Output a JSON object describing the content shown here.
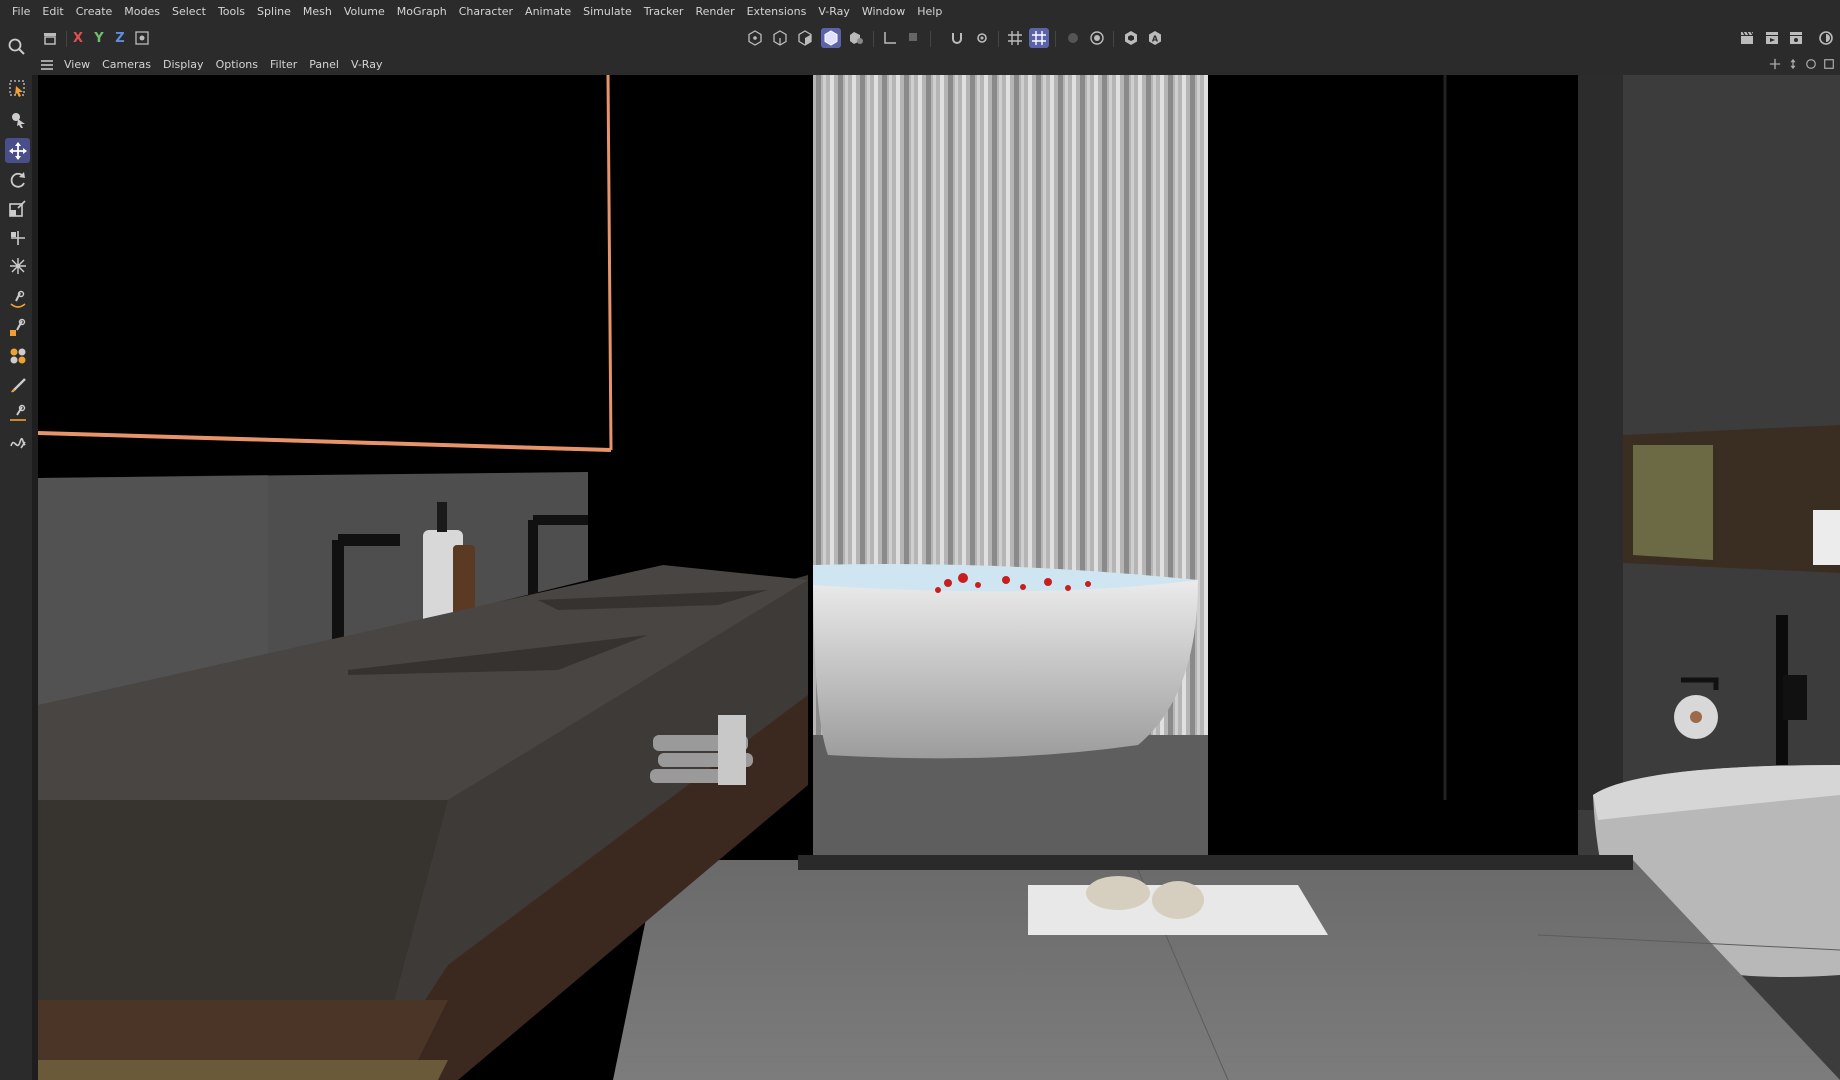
{
  "menubar": {
    "items": [
      "File",
      "Edit",
      "Create",
      "Modes",
      "Select",
      "Tools",
      "Spline",
      "Mesh",
      "Volume",
      "MoGraph",
      "Character",
      "Animate",
      "Simulate",
      "Tracker",
      "Render",
      "Extensions",
      "V-Ray",
      "Window",
      "Help"
    ]
  },
  "toolbar": {
    "axis_x": "X",
    "axis_y": "Y",
    "axis_z": "Z",
    "axis_colors": {
      "x": "#e05050",
      "y": "#70c070",
      "z": "#5b8fe0"
    },
    "active_color": "#5d63a8",
    "icons": [
      "search-icon",
      "undo-history-icon",
      "coordinate-system-icon",
      "points-mode-icon",
      "edges-mode-icon",
      "polygons-mode-icon",
      "model-mode-icon",
      "texture-mode-icon",
      "axis-mode-icon",
      "solo-icon",
      "snap-icon",
      "snap-settings-icon",
      "grid-icon",
      "workplane-icon",
      "render-region-icon",
      "render-active-icon",
      "vray-icon",
      "vray-auto-icon",
      "clapper-icon",
      "render-view-icon",
      "render-settings-icon"
    ]
  },
  "viewport_header": {
    "items": [
      "View",
      "Cameras",
      "Display",
      "Options",
      "Filter",
      "Panel",
      "V-Ray"
    ]
  },
  "palette": {
    "tools": [
      "selection-tool-icon",
      "live-select-icon",
      "move-tool-icon",
      "rotate-tool-icon",
      "scale-tool-icon",
      "transfer-tool-icon",
      "transform-tool-icon",
      "bend-tool-icon",
      "pencil-tool-icon",
      "cloner-tool-icon",
      "brush-tool-icon",
      "sculpt-tool-icon",
      "spline-pen-icon"
    ],
    "active_tool": "move-tool-icon"
  },
  "scene": {
    "description_visible": "3D bathroom viewport render",
    "accent_light": "#e8946a"
  }
}
